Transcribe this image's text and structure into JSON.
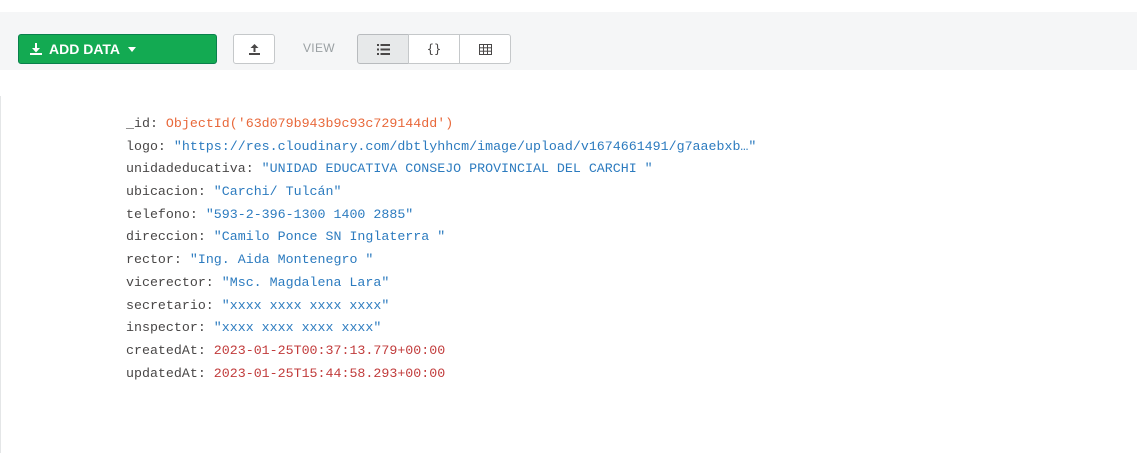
{
  "toolbar": {
    "add_data_label": "ADD DATA",
    "view_label": "VIEW",
    "icons": {
      "add_data": "download-icon",
      "export": "upload-icon",
      "list_view": "list-icon",
      "json_view": "braces-icon",
      "table_view": "table-icon"
    },
    "active_view": "list",
    "colors": {
      "add_data_bg": "#13aa52"
    }
  },
  "document": {
    "fields": [
      {
        "key": "_id",
        "value": "ObjectId('63d079b943b9c93c729144dd')",
        "kind": "objectid"
      },
      {
        "key": "logo",
        "value": "\"https://res.cloudinary.com/dbtlyhhcm/image/upload/v1674661491/g7aaebxb…\"",
        "kind": "string"
      },
      {
        "key": "unidadeducativa",
        "value": "\"UNIDAD EDUCATIVA CONSEJO PROVINCIAL DEL CARCHI \"",
        "kind": "string"
      },
      {
        "key": "ubicacion",
        "value": "\"Carchi/ Tulcán\"",
        "kind": "string"
      },
      {
        "key": "telefono",
        "value": "\"593-2-396-1300 1400 2885\"",
        "kind": "string"
      },
      {
        "key": "direccion",
        "value": "\"Camilo Ponce SN Inglaterra \"",
        "kind": "string"
      },
      {
        "key": "rector",
        "value": "\"Ing. Aida Montenegro \"",
        "kind": "string"
      },
      {
        "key": "vicerector",
        "value": "\"Msc. Magdalena Lara\"",
        "kind": "string"
      },
      {
        "key": "secretario",
        "value": "\"xxxx xxxx xxxx xxxx\"",
        "kind": "string"
      },
      {
        "key": "inspector",
        "value": "\"xxxx xxxx xxxx xxxx\"",
        "kind": "string"
      },
      {
        "key": "createdAt",
        "value": "2023-01-25T00:37:13.779+00:00",
        "kind": "date"
      },
      {
        "key": "updatedAt",
        "value": "2023-01-25T15:44:58.293+00:00",
        "kind": "date"
      }
    ]
  }
}
